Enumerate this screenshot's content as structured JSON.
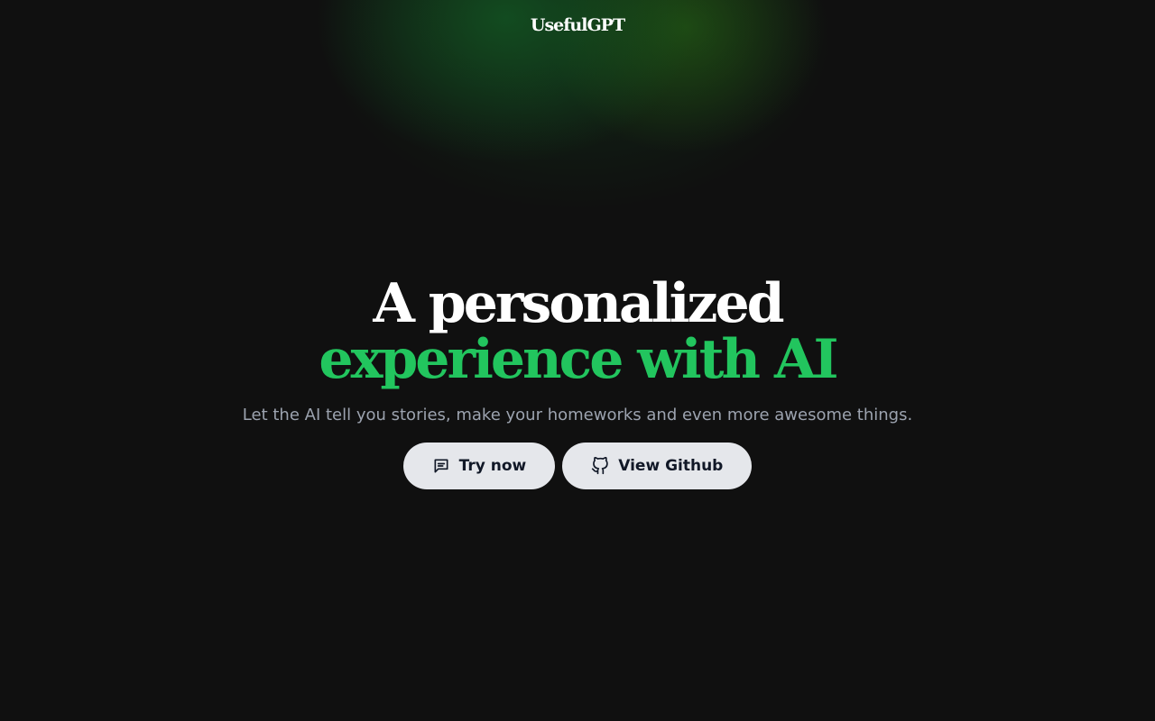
{
  "header": {
    "logo_text": "UsefulGPT"
  },
  "hero": {
    "headline_line1": "A personalized",
    "headline_line2": "experience with AI",
    "subtitle": "Let the AI tell you stories, make your homeworks and even more awesome things."
  },
  "actions": {
    "try_now": {
      "label": "Try now",
      "icon": "message-icon"
    },
    "view_github": {
      "label": "View Github",
      "icon": "github-icon"
    }
  },
  "colors": {
    "background": "#101010",
    "accent": "#22c55e",
    "button_bg": "#e5e7eb",
    "subtitle": "#9ca3af"
  }
}
